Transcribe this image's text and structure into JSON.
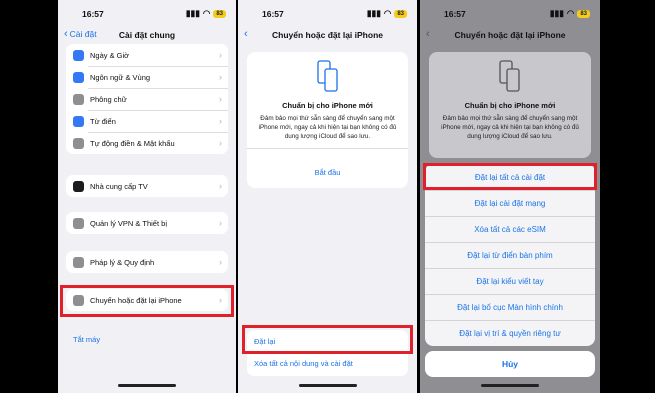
{
  "panel1": {
    "status": {
      "time": "16:57",
      "battery": "83"
    },
    "nav": {
      "back": "Cài đặt",
      "title": "Cài đặt chung"
    },
    "group_a": [
      {
        "label": "Ngày & Giờ",
        "icon": "calendar-icon",
        "color": "#3478f6"
      },
      {
        "label": "Ngôn ngữ & Vùng",
        "icon": "globe-icon",
        "color": "#3478f6"
      },
      {
        "label": "Phông chữ",
        "icon": "font-icon",
        "color": "#8e8e93"
      },
      {
        "label": "Từ điển",
        "icon": "book-icon",
        "color": "#3478f6"
      },
      {
        "label": "Tự động điền & Mật khẩu",
        "icon": "key-icon",
        "color": "#8e8e93"
      }
    ],
    "group_b": [
      {
        "label": "Nhà cung cấp TV",
        "icon": "tv-icon",
        "color": "#1c1c1e"
      }
    ],
    "group_c": [
      {
        "label": "Quản lý VPN & Thiết bị",
        "icon": "gear-icon",
        "color": "#8e8e93"
      }
    ],
    "group_d": [
      {
        "label": "Pháp lý & Quy định",
        "icon": "legal-icon",
        "color": "#8e8e93"
      }
    ],
    "group_e": [
      {
        "label": "Chuyển hoặc đặt lại iPhone",
        "icon": "reset-icon",
        "color": "#8e8e93"
      }
    ],
    "shutdown": "Tắt máy"
  },
  "panel2": {
    "status": {
      "time": "16:57",
      "battery": "83"
    },
    "nav": {
      "title": "Chuyển hoặc đặt lại iPhone"
    },
    "card": {
      "title": "Chuẩn bị cho iPhone mới",
      "desc": "Đảm bảo mọi thứ sẵn sàng để chuyển sang một iPhone mới, ngay cả khi hiện tại bạn không có đủ dung lượng iCloud để sao lưu.",
      "action": "Bắt đầu"
    },
    "reset_label": "Đặt lại",
    "erase_label": "Xóa tất cả nội dung và cài đặt"
  },
  "panel3": {
    "status": {
      "time": "16:57",
      "battery": "83"
    },
    "nav": {
      "title": "Chuyển hoặc đặt lại iPhone"
    },
    "card": {
      "title": "Chuẩn bị cho iPhone mới",
      "desc": "Đảm bảo mọi thứ sẵn sàng để chuyển sang một iPhone mới, ngay cả khi hiện tại bạn không có đủ dung lượng iCloud để sao lưu."
    },
    "options": [
      "Đặt lại tất cả cài đặt",
      "Đặt lại cài đặt mạng",
      "Xóa tất cả các eSIM",
      "Đặt lại từ điển bàn phím",
      "Đặt lại kiểu viết tay",
      "Đặt lại bố cục Màn hình chính",
      "Đặt lại vị trí & quyền riêng tư"
    ],
    "cancel": "Hủy"
  },
  "colors": {
    "accent": "#1a73e8",
    "highlight": "#e0202a",
    "battery": "#f4cc1c"
  }
}
